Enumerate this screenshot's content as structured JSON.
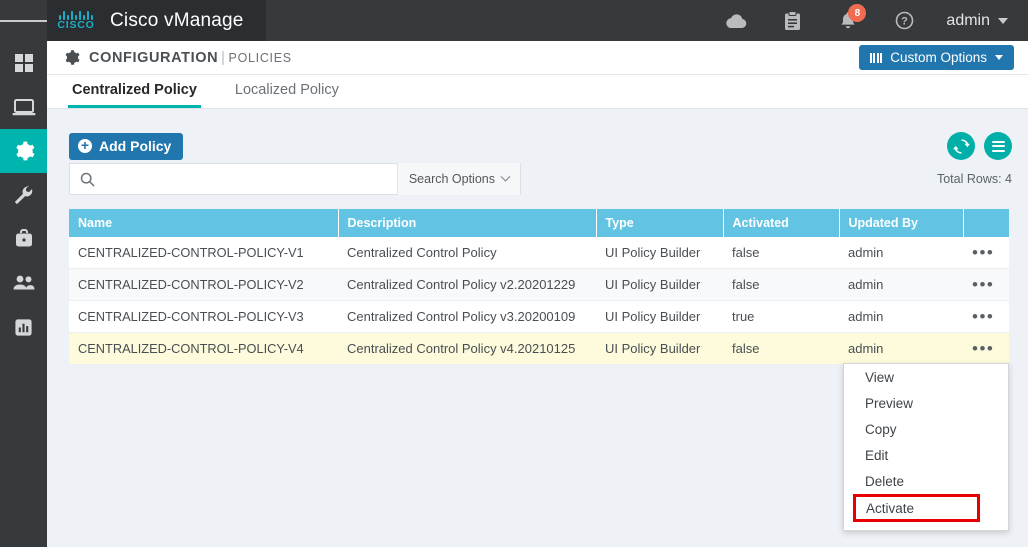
{
  "header": {
    "menu_icon": "hamburger-icon",
    "brand": "Cisco vManage",
    "logo_text": "CISCO",
    "icons": [
      {
        "name": "cloud-icon",
        "label": "Cloud"
      },
      {
        "name": "tasks-icon",
        "label": "Tasks"
      },
      {
        "name": "alarms-bell-icon",
        "label": "Alarms",
        "badge": "8"
      },
      {
        "name": "help-icon",
        "label": "Help"
      }
    ],
    "user": "admin"
  },
  "sidebar": {
    "items": [
      {
        "name": "sidebar-item-dashboard",
        "icon": "dashboard-grid-icon",
        "active": false
      },
      {
        "name": "sidebar-item-monitor",
        "icon": "monitor-laptop-icon",
        "active": false
      },
      {
        "name": "sidebar-item-configuration",
        "icon": "gear-icon",
        "active": true
      },
      {
        "name": "sidebar-item-tools",
        "icon": "wrench-icon",
        "active": false
      },
      {
        "name": "sidebar-item-maintenance",
        "icon": "briefcase-icon",
        "active": false
      },
      {
        "name": "sidebar-item-administration",
        "icon": "users-icon",
        "active": false
      },
      {
        "name": "sidebar-item-reports",
        "icon": "bar-chart-icon",
        "active": false
      }
    ]
  },
  "page": {
    "title": "CONFIGURATION",
    "separator": "|",
    "subtitle": "POLICIES",
    "custom_options_label": "Custom Options"
  },
  "tabs": [
    {
      "label": "Centralized Policy",
      "active": true
    },
    {
      "label": "Localized Policy",
      "active": false
    }
  ],
  "toolbar": {
    "add_policy_label": "Add Policy",
    "plus_glyph": "+",
    "refresh_icon": "refresh-icon",
    "list_icon": "list-menu-icon"
  },
  "search": {
    "value": "",
    "placeholder": "",
    "options_label": "Search Options",
    "icon": "search-icon"
  },
  "table": {
    "total_rows_label": "Total Rows: 4",
    "columns": [
      "Name",
      "Description",
      "Type",
      "Activated",
      "Updated By",
      ""
    ],
    "rows": [
      {
        "name": "CENTRALIZED-CONTROL-POLICY-V1",
        "description": "Centralized Control Policy",
        "type": "UI Policy Builder",
        "activated": "false",
        "updated_by": "admin",
        "actions": "•••"
      },
      {
        "name": "CENTRALIZED-CONTROL-POLICY-V2",
        "description": "Centralized Control Policy v2.20201229",
        "type": "UI Policy Builder",
        "activated": "false",
        "updated_by": "admin",
        "actions": "•••"
      },
      {
        "name": "CENTRALIZED-CONTROL-POLICY-V3",
        "description": "Centralized Control Policy v3.20200109",
        "type": "UI Policy Builder",
        "activated": "true",
        "updated_by": "admin",
        "actions": "•••"
      },
      {
        "name": "CENTRALIZED-CONTROL-POLICY-V4",
        "description": "Centralized Control Policy v4.20210125",
        "type": "UI Policy Builder",
        "activated": "false",
        "updated_by": "admin",
        "actions": "•••"
      }
    ]
  },
  "context_menu": {
    "items": [
      {
        "label": "View",
        "selected": false
      },
      {
        "label": "Preview",
        "selected": false
      },
      {
        "label": "Copy",
        "selected": false
      },
      {
        "label": "Edit",
        "selected": false
      },
      {
        "label": "Delete",
        "selected": false
      },
      {
        "label": "Activate",
        "selected": true
      }
    ]
  },
  "colors": {
    "header_bg": "#373a3c",
    "brand_teal": "#1badc8",
    "accent_teal": "#00b5ad",
    "primary_blue": "#2176ae",
    "table_header_blue": "#62c4e2",
    "row_highlight": "#fdfbdc",
    "badge_orange": "#f26c52",
    "selection_outline": "#e80000",
    "page_bg": "#eef1f6"
  }
}
